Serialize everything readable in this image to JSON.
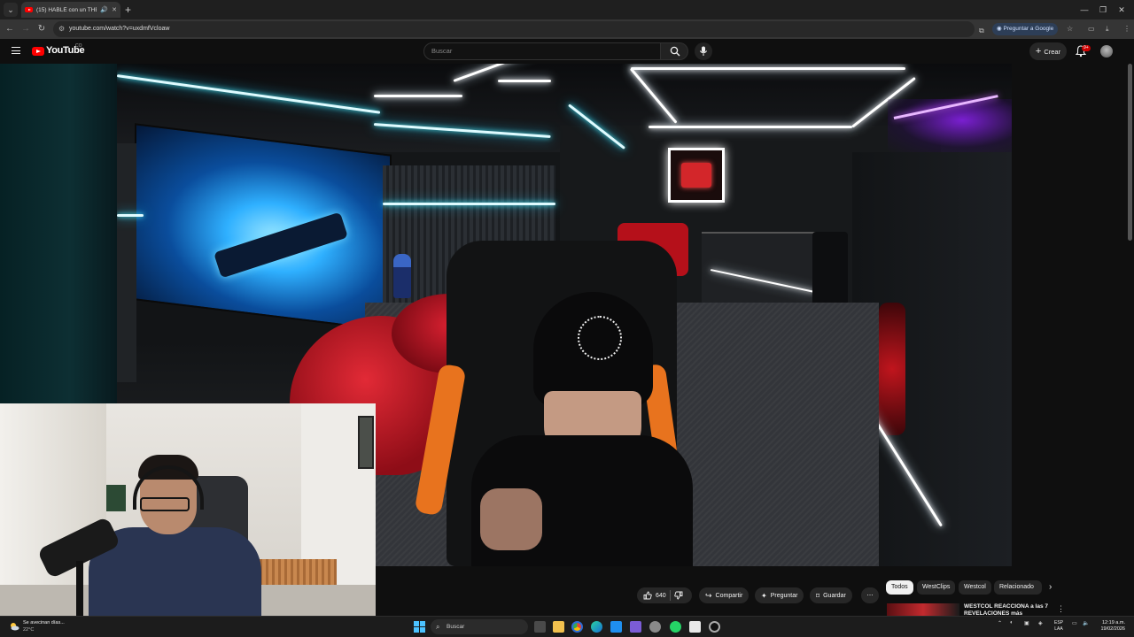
{
  "browser": {
    "tab_title": "(15) HABLÉ con un THERIA...",
    "url": "youtube.com/watch?v=uxdmfVcloaw",
    "ask_google": "Preguntar a Google"
  },
  "youtube": {
    "logo_text": "YouTube",
    "logo_suffix": "CO",
    "search_placeholder": "Buscar",
    "create_label": "Crear",
    "notification_count": "9+"
  },
  "video": {
    "likes": "640",
    "share_label": "Compartir",
    "ask_label": "Preguntar",
    "save_label": "Guardar"
  },
  "chips": [
    "Todos",
    "WestClips",
    "Westcol",
    "Relacionado"
  ],
  "recommendation": {
    "title": "WESTCOL REACCIONA a las 7 REVELACIONES más"
  },
  "taskbar": {
    "weather_line1": "Se avecinan días...",
    "weather_line2": "22°C",
    "search_label": "Buscar",
    "lang_line1": "ESP",
    "lang_line2": "LAA",
    "time": "12:19 a.m.",
    "date": "19/02/2026"
  },
  "icons": {
    "back": "back-arrow-icon",
    "forward": "forward-arrow-icon",
    "reload": "reload-icon",
    "search": "search-icon",
    "mic": "microphone-icon",
    "bell": "bell-icon",
    "like": "thumbs-up-icon",
    "dislike": "thumbs-down-icon"
  },
  "colors": {
    "youtube_red": "#ff0000",
    "page_bg": "#0f0f0f",
    "pill_bg": "#272727"
  }
}
